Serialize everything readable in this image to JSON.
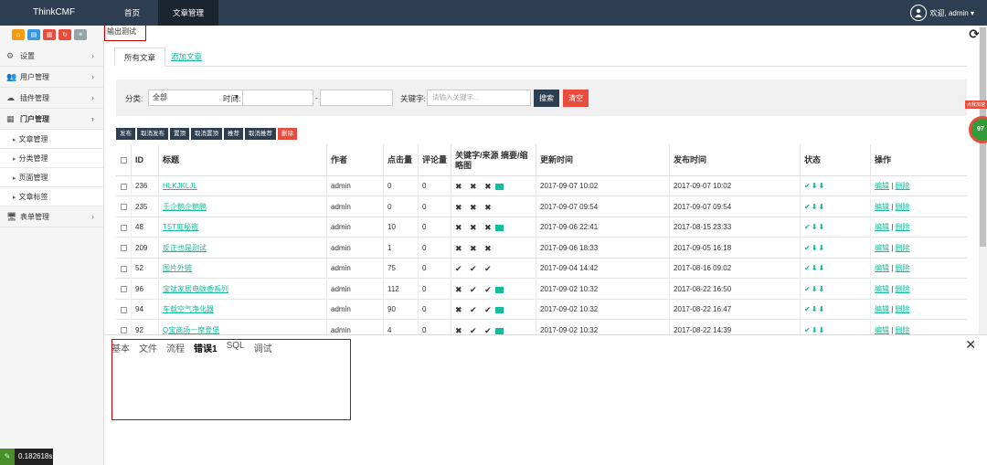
{
  "topbar": {
    "brand": "ThinkCMF",
    "nav": [
      {
        "label": "首页"
      },
      {
        "label": "文章管理"
      }
    ],
    "user_greeting": "欢迎, admin ▾"
  },
  "sidebar": {
    "shortcuts": [
      {
        "icon": "home-icon",
        "color": "#f39c12"
      },
      {
        "icon": "file-icon",
        "color": "#3498db"
      },
      {
        "icon": "trash-icon",
        "color": "#e74c3c"
      },
      {
        "icon": "refresh-icon",
        "color": "#e74c3c"
      },
      {
        "icon": "list-icon",
        "color": "#95a5a6"
      }
    ],
    "menu": [
      {
        "label": "设置",
        "icon": "gears-icon"
      },
      {
        "label": "用户管理",
        "icon": "users-icon"
      },
      {
        "label": "插件管理",
        "icon": "cloud-icon"
      },
      {
        "label": "门户管理",
        "icon": "grid-icon"
      }
    ],
    "submenu": [
      {
        "label": "文章管理"
      },
      {
        "label": "分类管理"
      },
      {
        "label": "页面管理"
      },
      {
        "label": "文章标签"
      }
    ],
    "last_menu": {
      "label": "表单管理",
      "icon": "desktop-icon"
    },
    "timing": "0.182618s"
  },
  "main": {
    "debug_title": "输出测试",
    "tabs": [
      {
        "label": "所有文章"
      },
      {
        "label": "添加文章"
      }
    ],
    "filter": {
      "category_label": "分类:",
      "category_value": "全部",
      "time_label": "时间:",
      "dash": "-",
      "keyword_label": "关键字:",
      "keyword_placeholder": "请输入关键字...",
      "search_btn": "搜索",
      "clear_btn": "清空"
    },
    "actions": [
      {
        "label": "发布"
      },
      {
        "label": "取消发布"
      },
      {
        "label": "置顶"
      },
      {
        "label": "取消置顶"
      },
      {
        "label": "推荐"
      },
      {
        "label": "取消推荐"
      },
      {
        "label": "删除"
      }
    ],
    "table": {
      "headers": [
        "ID",
        "标题",
        "作者",
        "点击量",
        "评论量",
        "关键字/来源 摘要/缩略图",
        "更新时间",
        "发布时间",
        "状态",
        "操作"
      ],
      "rows": [
        {
          "id": "236",
          "title": "HLKJKLJL",
          "author": "admin",
          "hits": "0",
          "comments": "0",
          "marks": "✖ ✖ ✖",
          "img": true,
          "updated": "2017-09-07 10:02",
          "published": "2017-09-07 10:02",
          "status": "✔⬇⬇",
          "edit": "编辑",
          "sep": "|",
          "del": "删除"
        },
        {
          "id": "235",
          "title": "王企鹅企鹅鹏",
          "author": "admin",
          "hits": "0",
          "comments": "0",
          "marks": "✖ ✖ ✖",
          "img": false,
          "updated": "2017-09-07 09:54",
          "published": "2017-09-07 09:54",
          "status": "✔⬇⬇",
          "edit": "编辑",
          "sep": "|",
          "del": "删除"
        },
        {
          "id": "48",
          "title": "TST庭秘密",
          "author": "admin",
          "hits": "10",
          "comments": "0",
          "marks": "✖ ✖ ✖",
          "img": true,
          "updated": "2017-09-06 22:41",
          "published": "2017-08-15 23:33",
          "status": "✔⬇⬇",
          "edit": "编辑",
          "sep": "|",
          "del": "删除"
        },
        {
          "id": "209",
          "title": "反正也是测试",
          "author": "admin",
          "hits": "1",
          "comments": "0",
          "marks": "✖ ✖ ✖",
          "img": false,
          "updated": "2017-09-06 18:33",
          "published": "2017-09-05 16:18",
          "status": "✔⬇⬇",
          "edit": "编辑",
          "sep": "|",
          "del": "删除"
        },
        {
          "id": "52",
          "title": "图片外链",
          "author": "admin",
          "hits": "75",
          "comments": "0",
          "marks": "✔ ✔ ✔",
          "img": false,
          "updated": "2017-09-04 14:42",
          "published": "2017-08-16 09:02",
          "status": "✔⬇⬇",
          "edit": "编辑",
          "sep": "|",
          "del": "删除"
        },
        {
          "id": "96",
          "title": "宝钛家居电蚊香系列",
          "author": "admin",
          "hits": "112",
          "comments": "0",
          "marks": "✖ ✔ ✔",
          "img": true,
          "updated": "2017-09-02 10:32",
          "published": "2017-08-22 16:50",
          "status": "✔⬇⬇",
          "edit": "编辑",
          "sep": "|",
          "del": "删除"
        },
        {
          "id": "94",
          "title": "车载空气净化器",
          "author": "admin",
          "hits": "90",
          "comments": "0",
          "marks": "✖ ✔ ✔",
          "img": true,
          "updated": "2017-09-02 10:32",
          "published": "2017-08-22 16:47",
          "status": "✔⬇⬇",
          "edit": "编辑",
          "sep": "|",
          "del": "删除"
        },
        {
          "id": "92",
          "title": "Q宝商场一摩登堡",
          "author": "admin",
          "hits": "4",
          "comments": "0",
          "marks": "✖ ✔ ✔",
          "img": true,
          "updated": "2017-09-02 10:32",
          "published": "2017-08-22 14:39",
          "status": "✔⬇⬇",
          "edit": "编辑",
          "sep": "|",
          "del": "删除"
        }
      ]
    }
  },
  "debug_panel": {
    "tabs": [
      {
        "label": "基本"
      },
      {
        "label": "文件"
      },
      {
        "label": "流程"
      },
      {
        "label": "错误1"
      },
      {
        "label": "SQL"
      },
      {
        "label": "调试"
      }
    ]
  },
  "right_widget": {
    "label": "点我加速",
    "value": "97"
  }
}
